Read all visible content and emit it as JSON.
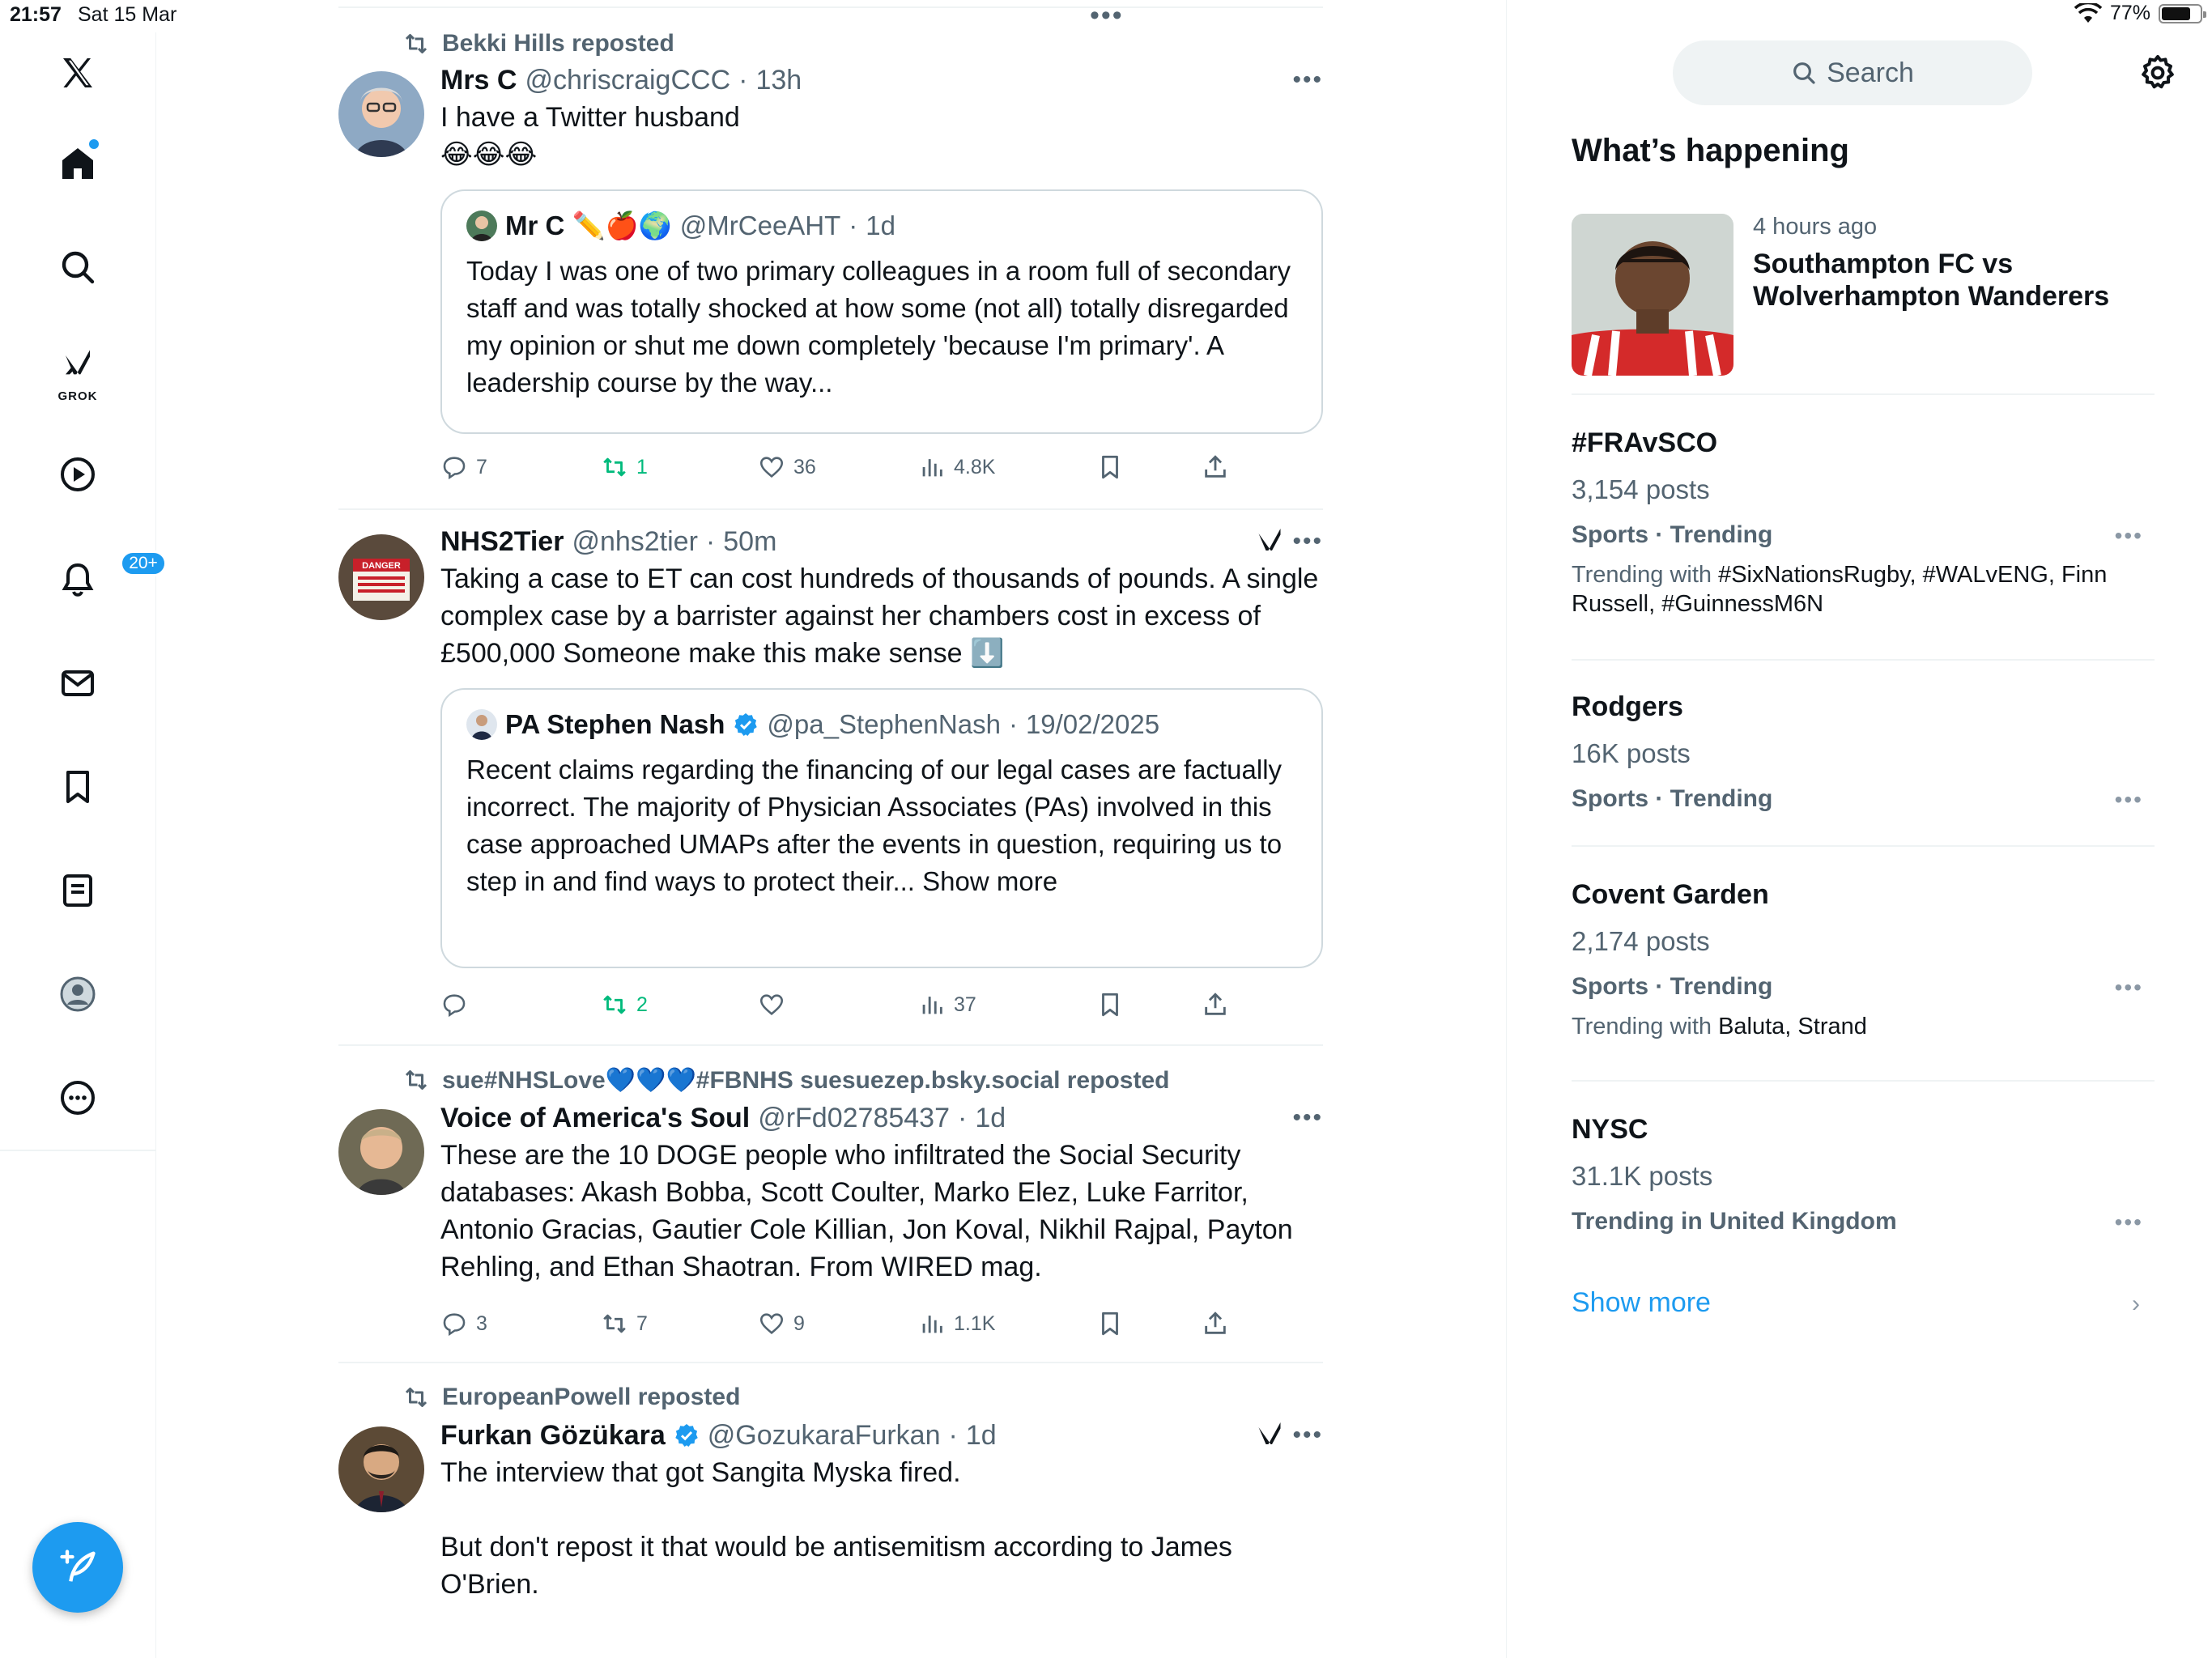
{
  "status_bar": {
    "time": "21:57",
    "date": "Sat 15 Mar",
    "battery": "77%",
    "battery_level": 0.77
  },
  "nav": {
    "grok_label": "GROK",
    "notifications_badge": "20+"
  },
  "feed": {
    "tweets": [
      {
        "repost_by": "Bekki Hills reposted",
        "name": "Mrs C",
        "handle": "@chriscraigCCC",
        "sep": "·",
        "time": "13h",
        "text": "I have a Twitter husband",
        "emoji": "😂😂😂",
        "quote": {
          "name": "Mr C ✏️🍎🌍",
          "handle": "@MrCeeAHT",
          "time": "1d",
          "text": "Today I was one of two primary colleagues in a room full of secondary staff and was totally shocked at how some (not all) totally disregarded my opinion or shut me down completely 'because I'm primary'. A leadership course by the way..."
        },
        "replies": "7",
        "reposts": "1",
        "likes": "36",
        "views": "4.8K"
      },
      {
        "name": "NHS2Tier",
        "handle": "@nhs2tier",
        "sep": "·",
        "time": "50m",
        "text": "Taking a case to ET can cost hundreds of thousands of pounds. A single complex case by a barrister against her chambers cost in excess of £500,000 Someone make this make sense ⬇️",
        "avatar_sign": "DANGER",
        "quote": {
          "name": "PA Stephen Nash",
          "handle": "@pa_StephenNash",
          "time": "19/02/2025",
          "text": "Recent claims regarding the financing of our legal cases are factually incorrect. The majority of Physician Associates (PAs) involved in this case approached UMAPs after the events in question, requiring us to step in and find ways to protect their... Show more"
        },
        "replies": "",
        "reposts": "2",
        "likes": "",
        "views": "37"
      },
      {
        "repost_by": "sue#NHSLove💙💙💙#FBNHS suesuezep.bsky.social reposted",
        "name": "Voice of America's Soul",
        "handle": "@rFd02785437",
        "sep": "·",
        "time": "1d",
        "text": "These are the 10 DOGE people who infiltrated the Social Security databases: Akash Bobba, Scott Coulter, Marko Elez, Luke Farritor, Antonio Gracias, Gautier Cole Killian, Jon Koval, Nikhil Rajpal, Payton Rehling, and Ethan Shaotran. From WIRED mag.",
        "replies": "3",
        "reposts": "7",
        "likes": "9",
        "views": "1.1K"
      },
      {
        "repost_by": "EuropeanPowell reposted",
        "name": "Furkan Gözükara",
        "handle": "@GozukaraFurkan",
        "sep": "·",
        "time": "1d",
        "text": "The interview that got Sangita Myska fired.\n\nBut don't repost it that would be antisemitism according to James O'Brien."
      }
    ]
  },
  "right": {
    "search_placeholder": "Search",
    "whats_happening": "What’s happening",
    "news": {
      "time": "4 hours ago",
      "title": "Southampton FC vs Wolverhampton Wanderers"
    },
    "trends": [
      {
        "name": "#FRAvSCO",
        "count": "3,154 posts",
        "category": "Sports · Trending",
        "with_label": "Trending with ",
        "with_tags": "#SixNationsRugby, #WALvENG, Finn Russell, #GuinnessM6N"
      },
      {
        "name": "Rodgers",
        "count": "16K posts",
        "category": "Sports · Trending"
      },
      {
        "name": "Covent Garden",
        "count": "2,174 posts",
        "category": "Sports · Trending",
        "with_label": "Trending with ",
        "with_tags": "Baluta, Strand"
      },
      {
        "name": "NYSC",
        "count": "31.1K posts",
        "category": "Trending in United Kingdom"
      }
    ],
    "show_more": "Show more"
  },
  "colors": {
    "accent": "#1d9bf0",
    "repost_green": "#00ba7c",
    "secondary_text": "#536471",
    "divider": "#eff3f4"
  },
  "icons": [
    "x-logo-icon",
    "home-icon",
    "search-icon",
    "grok-icon",
    "video-icon",
    "bell-icon",
    "mail-icon",
    "bookmark-icon",
    "lists-icon",
    "profile-icon",
    "more-icon",
    "compose-icon",
    "reply-icon",
    "repost-icon",
    "like-icon",
    "views-icon",
    "share-icon",
    "gear-icon",
    "verified-icon",
    "wifi-icon"
  ]
}
